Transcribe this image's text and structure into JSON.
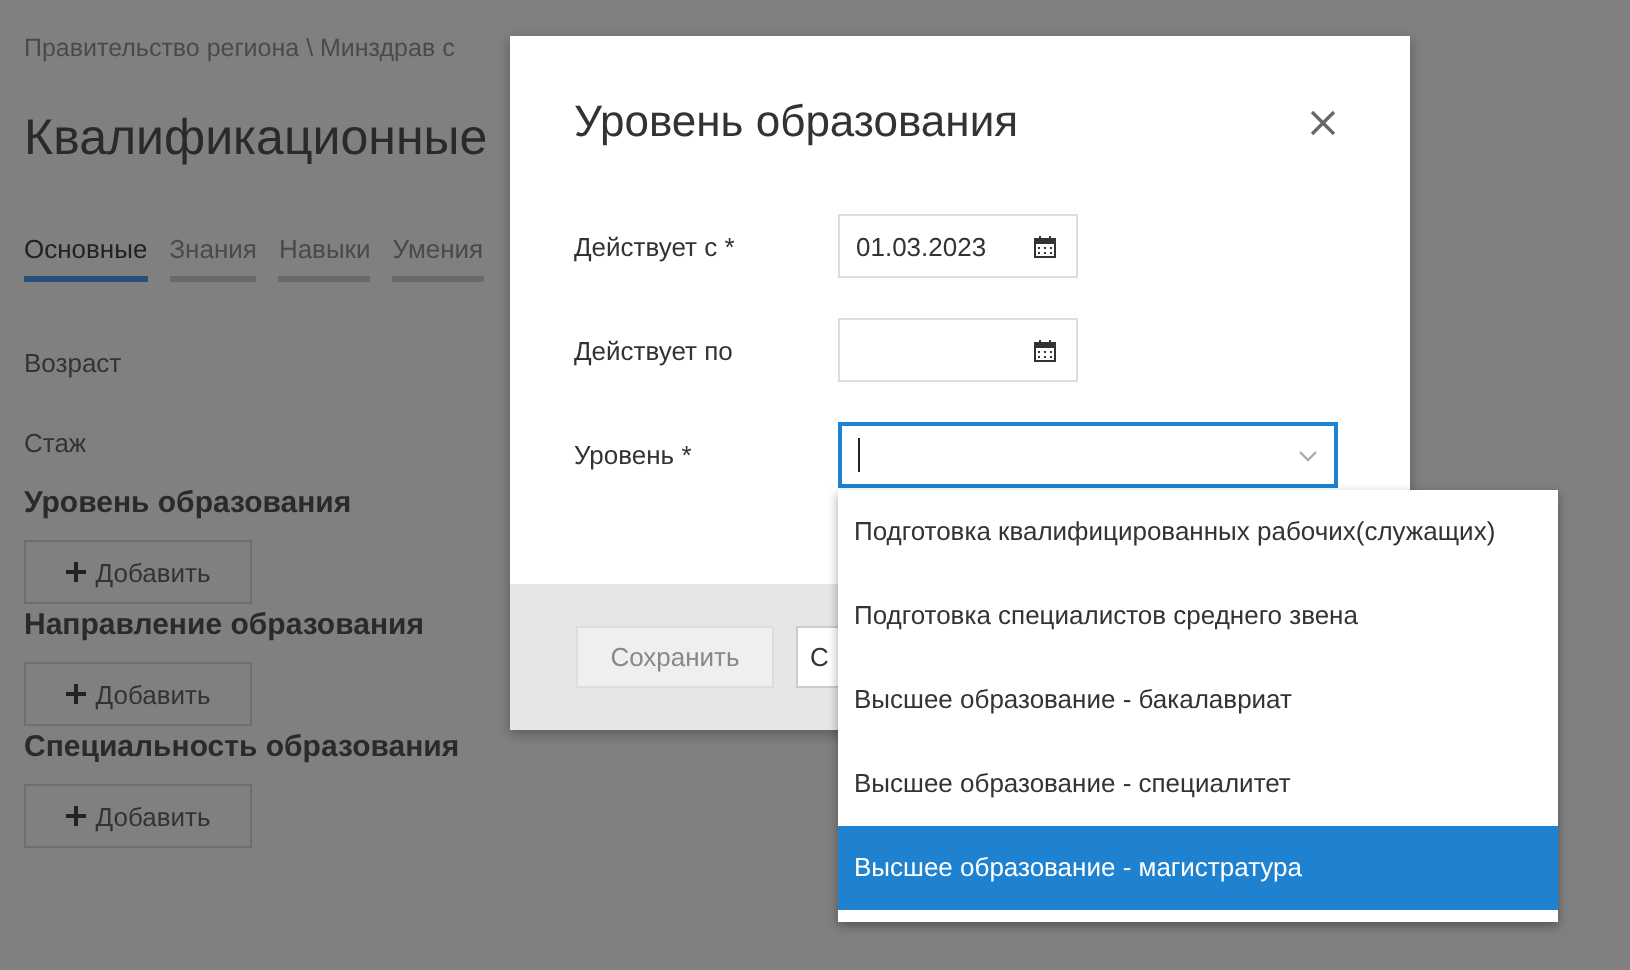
{
  "breadcrumb": "Правительство региона \\ Минздрав с",
  "page_title": "Квалификационные",
  "tabs": [
    {
      "label": "Основные",
      "selected": true
    },
    {
      "label": "Знания",
      "selected": false
    },
    {
      "label": "Навыки",
      "selected": false
    },
    {
      "label": "Умения",
      "selected": false
    }
  ],
  "fields": [
    {
      "label": "Возраст"
    },
    {
      "label": "Стаж"
    }
  ],
  "sections": [
    {
      "title": "Уровень образования",
      "button": "Добавить"
    },
    {
      "title": "Направление образования",
      "button": "Добавить"
    },
    {
      "title": "Специальность образования",
      "button": "Добавить"
    }
  ],
  "dialog": {
    "title": "Уровень образования",
    "fields": [
      {
        "kind": "date",
        "label": "Действует с *",
        "value": "01.03.2023"
      },
      {
        "kind": "date",
        "label": "Действует по"
      },
      {
        "kind": "select",
        "label": "Уровень *",
        "focused": true
      }
    ],
    "buttons": [
      {
        "label": "Сохранить",
        "disabled": true
      },
      {
        "label": "С",
        "disabled": false
      }
    ]
  },
  "dropdown": {
    "options": [
      {
        "label": "Подготовка квалифицированных рабочих(служащих)",
        "selected": false
      },
      {
        "label": "Подготовка специалистов среднего звена",
        "selected": false
      },
      {
        "label": "Высшее образование - бакалавриат",
        "selected": false
      },
      {
        "label": "Высшее образование - специалитет",
        "selected": false
      },
      {
        "label": "Высшее образование - магистратура",
        "selected": true
      }
    ]
  }
}
